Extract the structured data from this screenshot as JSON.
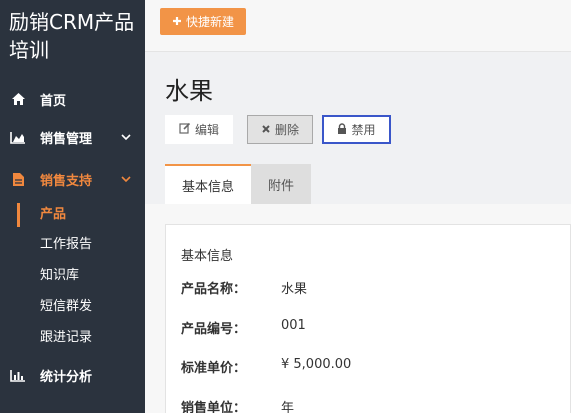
{
  "app": {
    "brand": "励销CRM产品培训",
    "quick_new": "快捷新建"
  },
  "sidebar": {
    "items": [
      {
        "label": "首页",
        "icon": "home-icon"
      },
      {
        "label": "销售管理",
        "icon": "area-chart-icon"
      },
      {
        "label": "销售支持",
        "icon": "document-icon"
      },
      {
        "label": "统计分析",
        "icon": "bar-chart-icon"
      }
    ],
    "sub_items": [
      {
        "label": "产品"
      },
      {
        "label": "工作报告"
      },
      {
        "label": "知识库"
      },
      {
        "label": "短信群发"
      },
      {
        "label": "跟进记录"
      }
    ]
  },
  "page": {
    "title": "水果",
    "actions": {
      "edit": "编辑",
      "delete": "删除",
      "disable": "禁用"
    },
    "tabs": [
      {
        "label": "基本信息"
      },
      {
        "label": "附件"
      }
    ],
    "section_title": "基本信息",
    "fields": [
      {
        "label": "产品名称：",
        "value": "水果"
      },
      {
        "label": "产品编号：",
        "value": "001"
      },
      {
        "label": "标准单价：",
        "value": "¥ 5,000.00"
      },
      {
        "label": "销售单位：",
        "value": "年"
      }
    ]
  },
  "colors": {
    "sidebar_bg": "#2b333e",
    "accent": "#f0883e",
    "quick_button": "#f29447",
    "focus_border": "#3a56c9"
  }
}
